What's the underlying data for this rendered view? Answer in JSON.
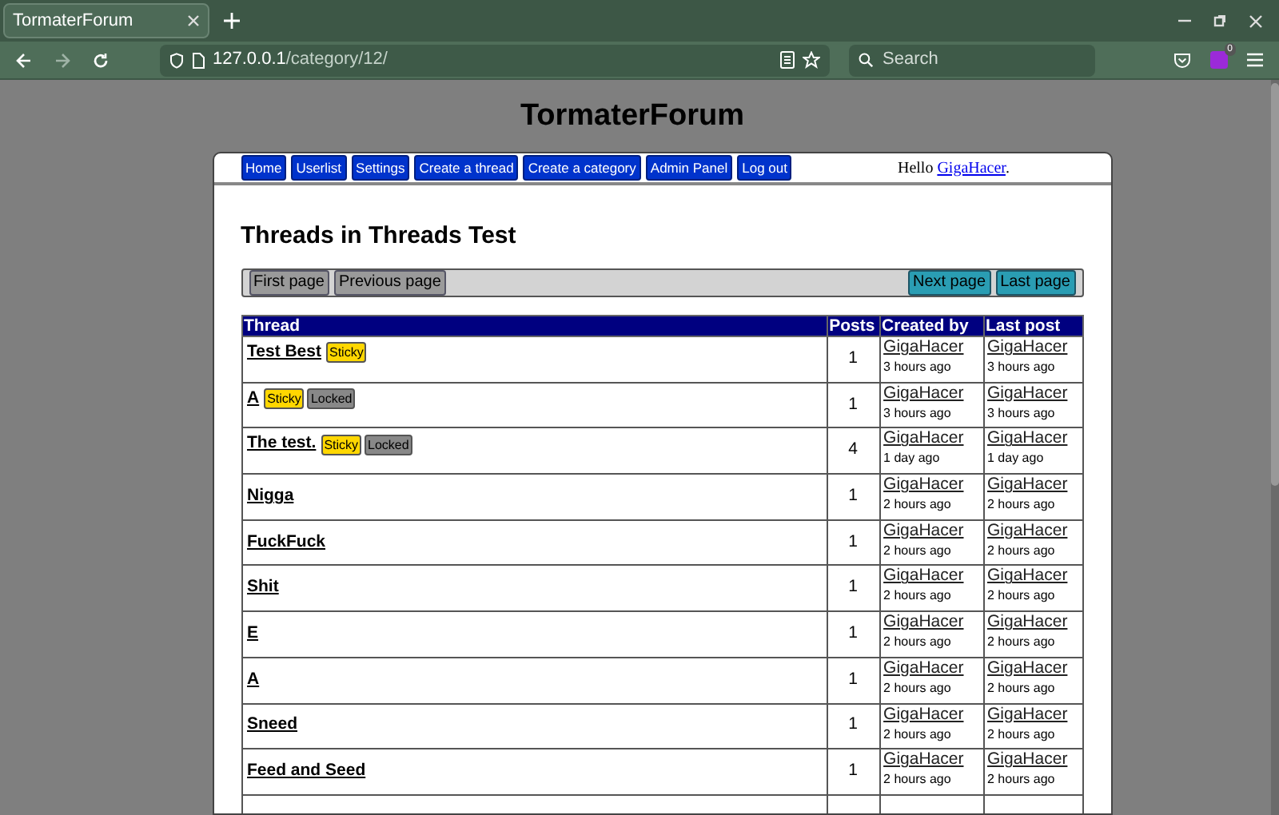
{
  "browser": {
    "tab_title": "TormaterForum",
    "url_host": "127.0.0.1",
    "url_path": "/category/12/",
    "search_placeholder": "Search",
    "extension_badge": "0"
  },
  "site_title": "TormaterForum",
  "nav": [
    "Home",
    "Userlist",
    "Settings",
    "Create a thread",
    "Create a category",
    "Admin Panel",
    "Log out"
  ],
  "greeting": {
    "prefix": "Hello ",
    "user": "GigaHacer",
    "suffix": "."
  },
  "heading": "Threads in Threads Test",
  "pagination": [
    {
      "label": "First page",
      "kind": "back"
    },
    {
      "label": "Previous page",
      "kind": "back"
    },
    {
      "label": "Next page",
      "kind": "forward"
    },
    {
      "label": "Last page",
      "kind": "forward"
    }
  ],
  "table": {
    "columns": [
      "Thread",
      "Posts",
      "Created by",
      "Last post"
    ],
    "rows": [
      {
        "title": "Test Best",
        "badges": [
          {
            "kind": "sticky",
            "label": "Sticky"
          }
        ],
        "posts": "1",
        "created_by": {
          "user": "GigaHacer",
          "time": "3 hours ago"
        },
        "last_post": {
          "user": "GigaHacer",
          "time": "3 hours ago"
        }
      },
      {
        "title": "A",
        "badges": [
          {
            "kind": "sticky",
            "label": "Sticky"
          },
          {
            "kind": "locked",
            "label": "Locked"
          }
        ],
        "posts": "1",
        "created_by": {
          "user": "GigaHacer",
          "time": "3 hours ago"
        },
        "last_post": {
          "user": "GigaHacer",
          "time": "3 hours ago"
        }
      },
      {
        "title": "The test.",
        "badges": [
          {
            "kind": "sticky",
            "label": "Sticky"
          },
          {
            "kind": "locked",
            "label": "Locked"
          }
        ],
        "posts": "4",
        "created_by": {
          "user": "GigaHacer",
          "time": "1 day ago"
        },
        "last_post": {
          "user": "GigaHacer",
          "time": "1 day ago"
        }
      },
      {
        "title": "Nigga",
        "posts": "1",
        "created_by": {
          "user": "GigaHacer",
          "time": "2 hours ago"
        },
        "last_post": {
          "user": "GigaHacer",
          "time": "2 hours ago"
        }
      },
      {
        "title": "FuckFuck",
        "posts": "1",
        "created_by": {
          "user": "GigaHacer",
          "time": "2 hours ago"
        },
        "last_post": {
          "user": "GigaHacer",
          "time": "2 hours ago"
        }
      },
      {
        "title": "Shit",
        "posts": "1",
        "created_by": {
          "user": "GigaHacer",
          "time": "2 hours ago"
        },
        "last_post": {
          "user": "GigaHacer",
          "time": "2 hours ago"
        }
      },
      {
        "title": "E",
        "posts": "1",
        "created_by": {
          "user": "GigaHacer",
          "time": "2 hours ago"
        },
        "last_post": {
          "user": "GigaHacer",
          "time": "2 hours ago"
        }
      },
      {
        "title": "A",
        "posts": "1",
        "created_by": {
          "user": "GigaHacer",
          "time": "2 hours ago"
        },
        "last_post": {
          "user": "GigaHacer",
          "time": "2 hours ago"
        }
      },
      {
        "title": "Sneed",
        "posts": "1",
        "created_by": {
          "user": "GigaHacer",
          "time": "2 hours ago"
        },
        "last_post": {
          "user": "GigaHacer",
          "time": "2 hours ago"
        }
      },
      {
        "title": "Feed and Seed",
        "posts": "1",
        "created_by": {
          "user": "GigaHacer",
          "time": "2 hours ago"
        },
        "last_post": {
          "user": "GigaHacer",
          "time": "2 hours ago"
        }
      }
    ]
  }
}
